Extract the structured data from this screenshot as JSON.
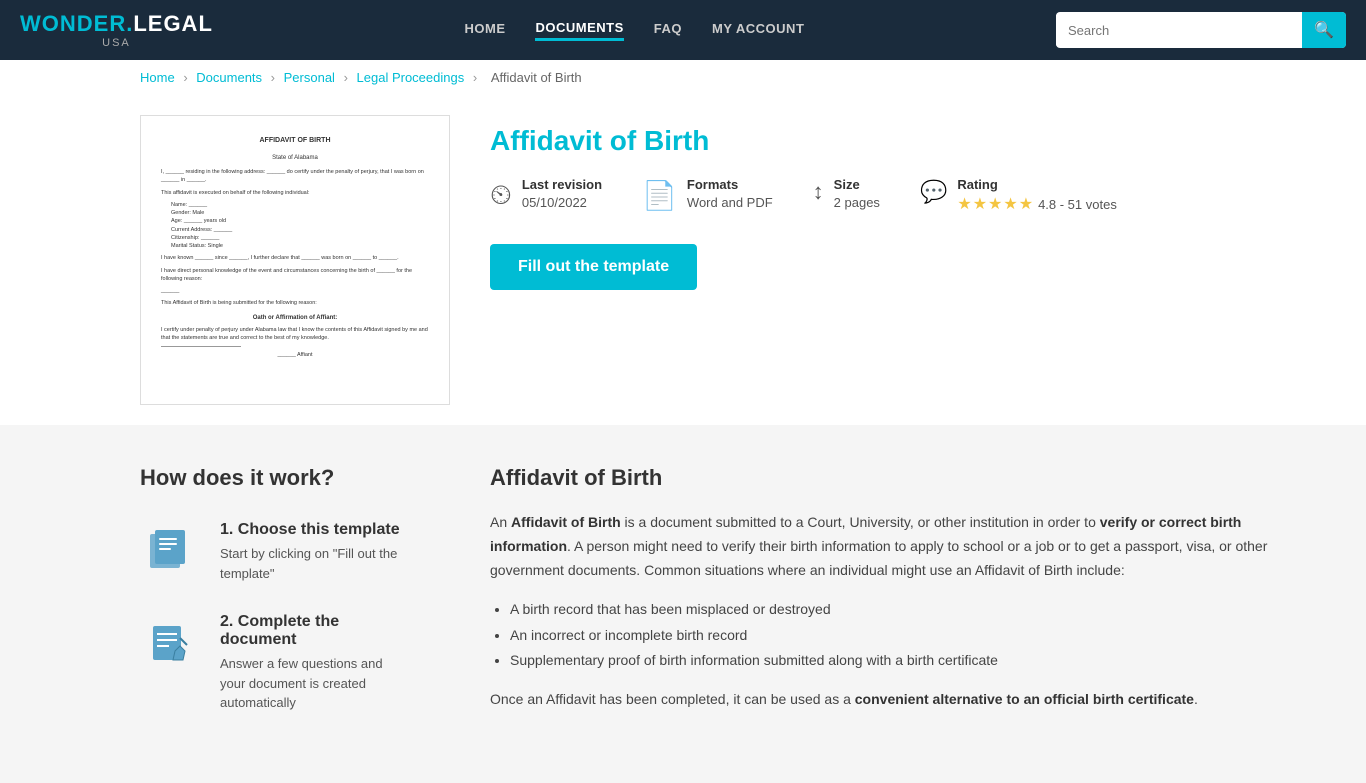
{
  "header": {
    "logo": {
      "text_wonder": "WONDER.",
      "text_legal": "LEGAL",
      "subtext": "USA"
    },
    "nav": [
      {
        "label": "HOME",
        "active": false
      },
      {
        "label": "DOCUMENTS",
        "active": true
      },
      {
        "label": "FAQ",
        "active": false
      },
      {
        "label": "MY ACCOUNT",
        "active": false
      }
    ],
    "search": {
      "placeholder": "Search",
      "button_icon": "🔍"
    }
  },
  "breadcrumb": {
    "items": [
      "Home",
      "Documents",
      "Personal",
      "Legal Proceedings"
    ],
    "current": "Affidavit of Birth"
  },
  "product": {
    "title": "Affidavit of Birth",
    "meta": {
      "last_revision_label": "Last revision",
      "last_revision_value": "05/10/2022",
      "formats_label": "Formats",
      "formats_value": "Word and PDF",
      "size_label": "Size",
      "size_value": "2 pages",
      "rating_label": "Rating",
      "rating_value": "4.8 - 51 votes"
    },
    "cta_label": "Fill out the template"
  },
  "how_it_works": {
    "title": "How does it work?",
    "steps": [
      {
        "number": "1.",
        "title": "Choose this template",
        "desc": "Start by clicking on \"Fill out the template\""
      },
      {
        "number": "2.",
        "title": "Complete the document",
        "desc": "Answer a few questions and your document is created automatically"
      }
    ]
  },
  "description": {
    "title": "Affidavit of Birth",
    "intro": "An ",
    "intro_bold": "Affidavit of Birth",
    "intro_cont": " is a document submitted to a Court, University, or other institution in order to ",
    "intro_bold2": "verify or correct birth information",
    "intro_cont2": ". A person might need to verify their birth information to apply to school or a job or to get a passport, visa, or other government documents. Common situations where an individual might use an Affidavit of Birth include:",
    "bullets": [
      "A birth record that has been misplaced or destroyed",
      "An incorrect or incomplete birth record",
      "Supplementary proof of birth information submitted along with a birth certificate"
    ],
    "outro": "Once an Affidavit has been completed, it can be used as a ",
    "outro_bold": "convenient alternative to an official birth certificate",
    "outro_end": "."
  },
  "document_preview": {
    "title": "AFFIDAVIT OF BIRTH",
    "state": "State of Alabama",
    "body_lines": [
      "I, _______, residing in the following address: _______ do certify under the penalty of perjury, that I",
      "was born on _______ in _______.",
      "",
      "This affidavit is executed on behalf of the following individual:",
      "",
      "    Name: _______",
      "    Gender: Male",
      "    Age: _______ years old",
      "    Current Address: _______",
      "    Citizenship: _______",
      "    Marital Status: Single",
      "",
      "I have known _______ since _______, I further declare that _______ was born on _______ to",
      "_______.",
      "",
      "I have direct personal knowledge of the event and circumstances concerning the birth of _______ for the",
      "following reason:",
      "",
      "_______",
      "",
      "This Affidavit of Birth is being submitted for the following reason:",
      "",
      "_______",
      "",
      "Oath or Affirmation of Affiant:",
      "",
      "I certify under penalty of perjury under Alabama law that I know the contents of this Affidavit signed by",
      "me and that the statements are true and correct to the best of my knowledge.",
      "",
      "_______",
      "_______ Affiant"
    ]
  }
}
